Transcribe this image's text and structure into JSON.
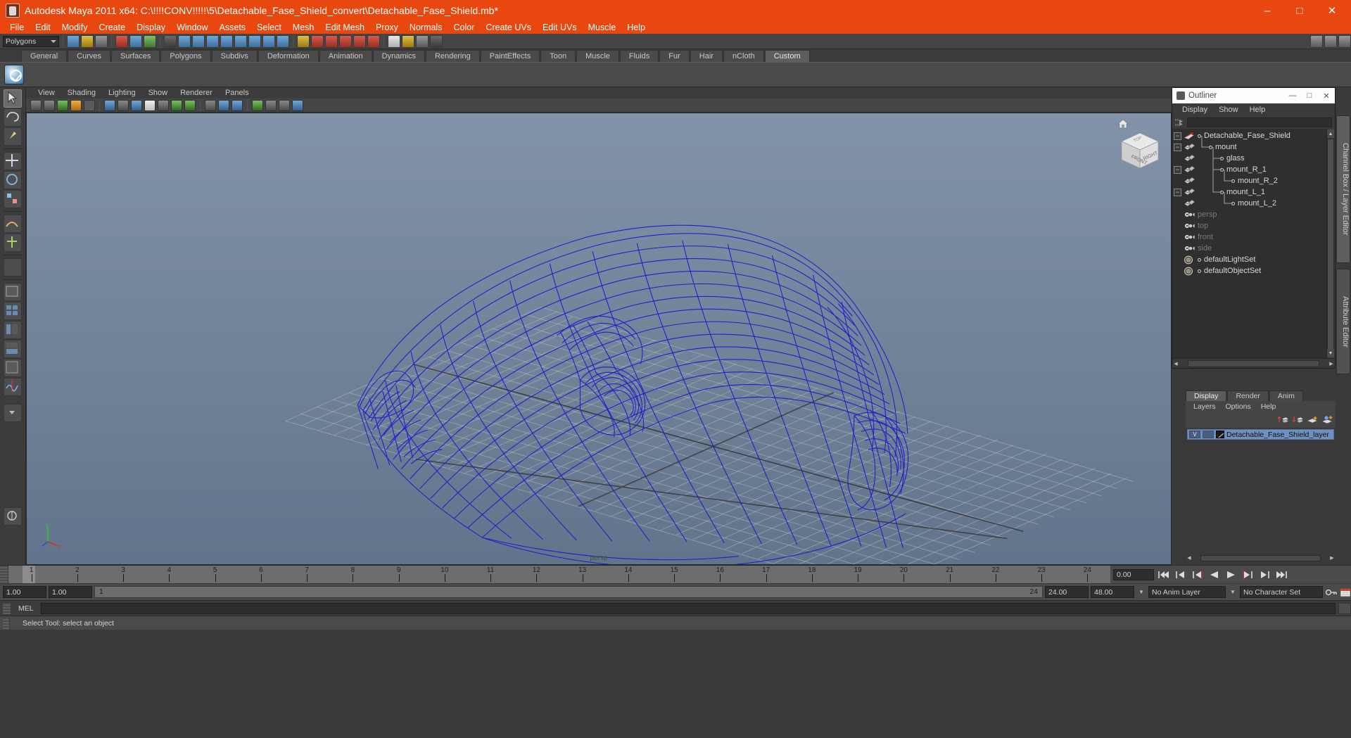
{
  "window": {
    "title": "Autodesk Maya 2011 x64: C:\\!!!!CONV!!!!!\\5\\Detachable_Fase_Shield_convert\\Detachable_Fase_Shield.mb*",
    "app_icon": "maya-icon",
    "minimize": "–",
    "maximize": "□",
    "close": "✕",
    "accent": "#e8470f"
  },
  "menubar": {
    "items": [
      "File",
      "Edit",
      "Modify",
      "Create",
      "Display",
      "Window",
      "Assets",
      "Select",
      "Mesh",
      "Edit Mesh",
      "Proxy",
      "Normals",
      "Color",
      "Create UVs",
      "Edit UVs",
      "Muscle",
      "Help"
    ]
  },
  "statusrow": {
    "mode_selected": "Polygons"
  },
  "shelf": {
    "tabs": [
      "General",
      "Curves",
      "Surfaces",
      "Polygons",
      "Subdivs",
      "Deformation",
      "Animation",
      "Dynamics",
      "Rendering",
      "PaintEffects",
      "Toon",
      "Muscle",
      "Fluids",
      "Fur",
      "Hair",
      "nCloth",
      "Custom"
    ],
    "active_tab": "Custom"
  },
  "panel": {
    "menus": [
      "View",
      "Shading",
      "Lighting",
      "Show",
      "Renderer",
      "Panels"
    ],
    "viewport_label": "persp",
    "view_cube": {
      "front": "FRONT",
      "right": "RIGHT",
      "top": "TOP"
    },
    "axis": {
      "x": "x",
      "y": "y",
      "z": "z"
    }
  },
  "outliner": {
    "title": "Outliner",
    "minimize": "—",
    "maximize": "□",
    "close": "✕",
    "menus": [
      "Display",
      "Show",
      "Help"
    ],
    "search_value": "",
    "tree": [
      {
        "label": "Detachable_Fase_Shield",
        "depth": 0,
        "expandable": true,
        "icon": "transform-icon",
        "dim": false
      },
      {
        "label": "mount",
        "depth": 1,
        "expandable": true,
        "icon": "mesh-icon",
        "dim": false
      },
      {
        "label": "glass",
        "depth": 2,
        "expandable": false,
        "icon": "mesh-icon",
        "dim": false
      },
      {
        "label": "mount_R_1",
        "depth": 2,
        "expandable": true,
        "icon": "mesh-icon",
        "dim": false
      },
      {
        "label": "mount_R_2",
        "depth": 3,
        "expandable": false,
        "icon": "mesh-icon",
        "dim": false
      },
      {
        "label": "mount_L_1",
        "depth": 2,
        "expandable": true,
        "icon": "mesh-icon",
        "dim": false
      },
      {
        "label": "mount_L_2",
        "depth": 3,
        "expandable": false,
        "icon": "mesh-icon",
        "dim": false
      },
      {
        "label": "persp",
        "depth": 0,
        "expandable": false,
        "icon": "camera-icon",
        "dim": true
      },
      {
        "label": "top",
        "depth": 0,
        "expandable": false,
        "icon": "camera-icon",
        "dim": true
      },
      {
        "label": "front",
        "depth": 0,
        "expandable": false,
        "icon": "camera-icon",
        "dim": true
      },
      {
        "label": "side",
        "depth": 0,
        "expandable": false,
        "icon": "camera-icon",
        "dim": true
      },
      {
        "label": "defaultLightSet",
        "depth": 0,
        "expandable": false,
        "icon": "set-icon",
        "dim": false
      },
      {
        "label": "defaultObjectSet",
        "depth": 0,
        "expandable": false,
        "icon": "set-icon",
        "dim": false
      }
    ]
  },
  "right_tabs": [
    {
      "label": "Channel Box / Layer Editor",
      "active": true
    },
    {
      "label": "Attribute Editor",
      "active": false
    }
  ],
  "layer_editor": {
    "tabs": [
      "Display",
      "Render",
      "Anim"
    ],
    "active_tab": "Display",
    "menus": [
      "Layers",
      "Options",
      "Help"
    ],
    "tool_icons": [
      "move-layer-up-icon",
      "move-layer-down-icon",
      "new-layer-icon",
      "new-layer-from-selected-icon"
    ],
    "layers": [
      {
        "visibility": "V",
        "playback": "",
        "name": "Detachable_Fase_Shield_layer",
        "selected": true
      }
    ]
  },
  "timeline": {
    "ticks": [
      "1",
      "2",
      "3",
      "4",
      "5",
      "6",
      "7",
      "8",
      "9",
      "10",
      "11",
      "12",
      "13",
      "14",
      "15",
      "16",
      "17",
      "18",
      "19",
      "20",
      "21",
      "22",
      "23",
      "24"
    ],
    "current_frame_display": "0.00",
    "playback_buttons": [
      "go-to-start-icon",
      "step-back-key-icon",
      "step-back-frame-icon",
      "play-backwards-icon",
      "play-forwards-icon",
      "step-forward-frame-icon",
      "step-forward-key-icon",
      "go-to-end-icon"
    ]
  },
  "range": {
    "anim_start": "1.00",
    "anim_end": "1.00",
    "range_start_label": "1",
    "range_end_label": "24",
    "playback_end": "24.00",
    "anim_total": "48.00",
    "anim_layer": "No Anim Layer",
    "character_set": "No Character Set",
    "key_icon": "key-icon",
    "calendar_icon": "auto-key-icon"
  },
  "command_line": {
    "language_label": "MEL",
    "input_value": ""
  },
  "status": {
    "message": "Select Tool: select an object"
  }
}
